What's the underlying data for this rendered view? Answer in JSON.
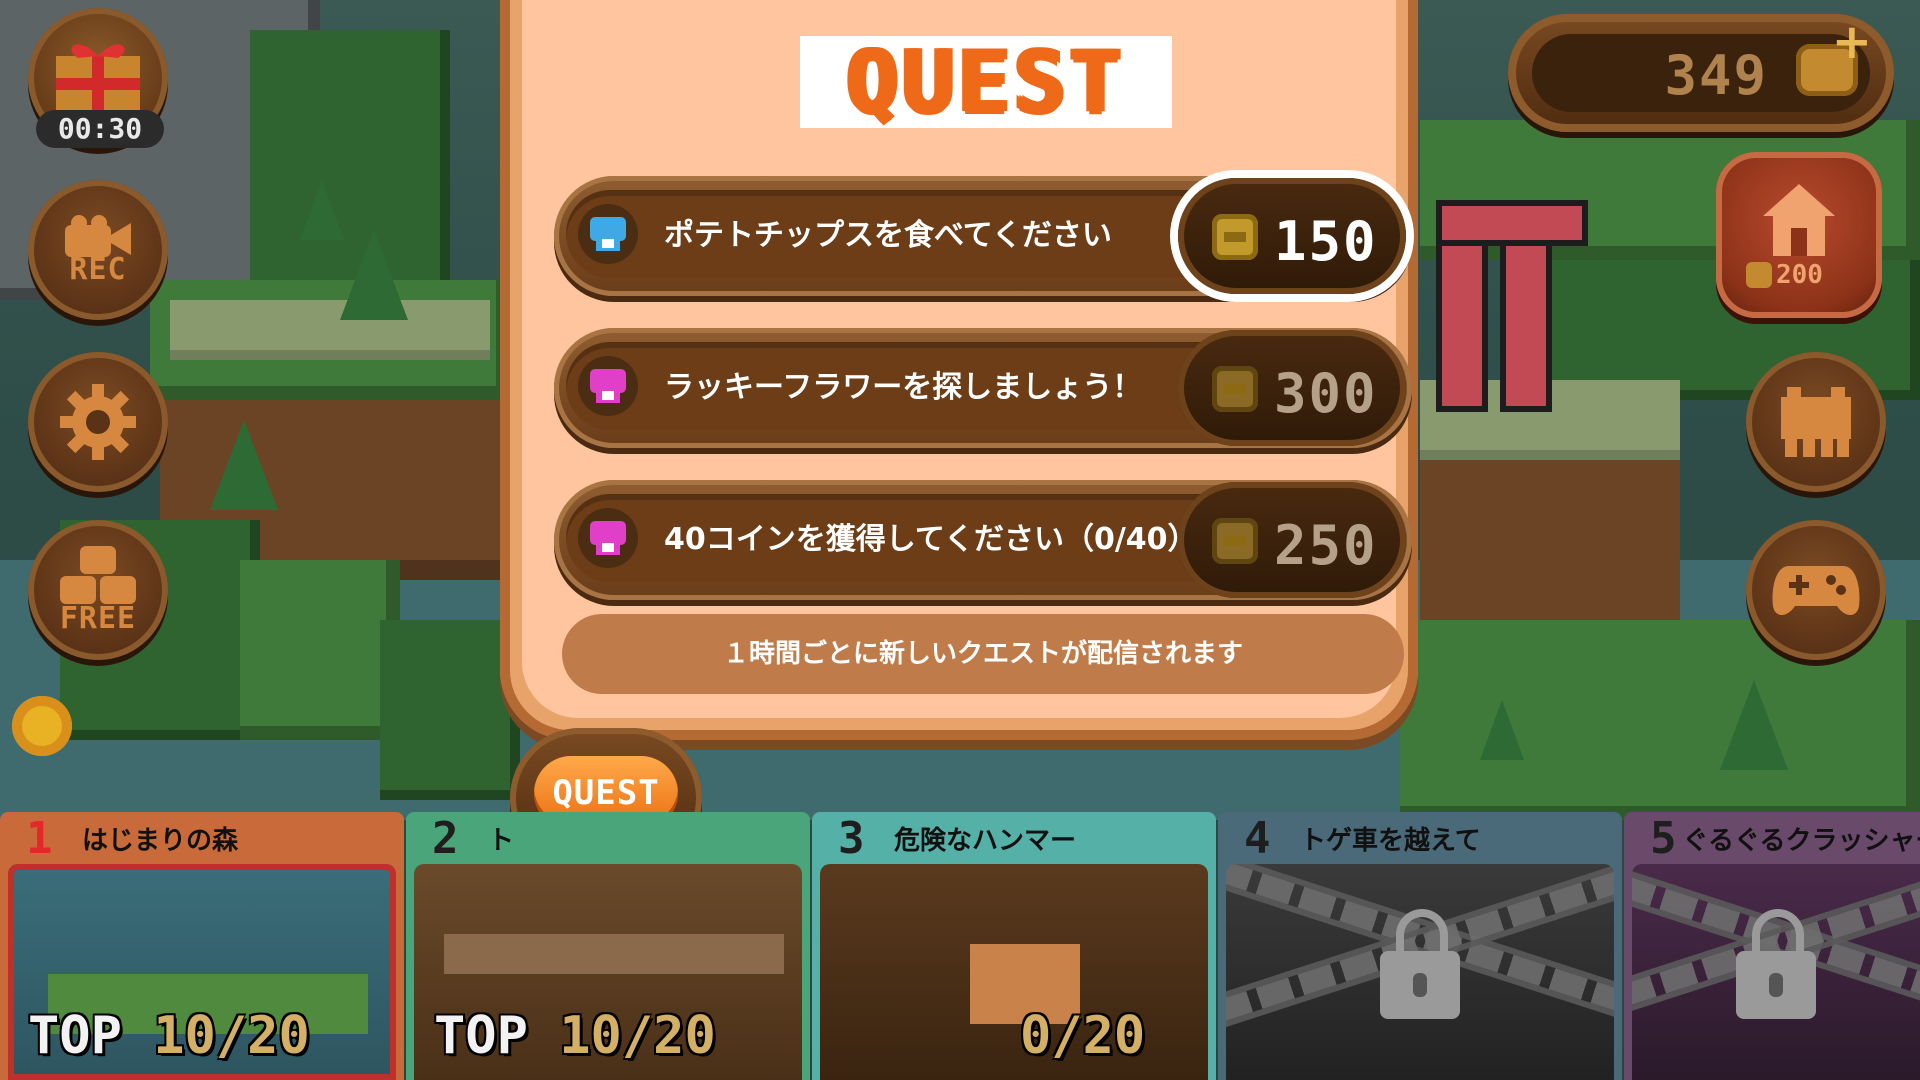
{
  "hud": {
    "gift_timer": "00:30",
    "rec_label": "REC",
    "free_label": "FREE",
    "coins": "349",
    "house_price": "200"
  },
  "quest_panel": {
    "title": "QUEST",
    "quests": [
      {
        "text": "ポテトチップスを食べてください",
        "reward": "150",
        "icon_color": "#3fa9e6",
        "active": true
      },
      {
        "text": "ラッキーフラワーを探しましょう！",
        "reward": "300",
        "icon_color": "#e040c8",
        "active": false
      },
      {
        "text": "40コインを獲得してください（0/40）",
        "reward": "250",
        "icon_color": "#e040c8",
        "active": false
      }
    ],
    "notice": "１時間ごとに新しいクエストが配信されます"
  },
  "quest_button": {
    "label": "QUEST"
  },
  "stages": [
    {
      "num": "1",
      "name": "はじまりの森",
      "score_prefix": "TOP",
      "score": "10/20",
      "locked": false,
      "color": "#c86a3a"
    },
    {
      "num": "2",
      "name": "ト",
      "score_prefix": "TOP",
      "score": "10/20",
      "locked": false,
      "color": "#4aa57a"
    },
    {
      "num": "3",
      "name": "危険なハンマー",
      "score_prefix": "",
      "score": "0/20",
      "locked": false,
      "color": "#55b0a8"
    },
    {
      "num": "4",
      "name": "トゲ車を越えて",
      "score_prefix": "",
      "score": "",
      "locked": true,
      "color": "#4a6a7a"
    },
    {
      "num": "5",
      "name": "ぐるぐるクラッシャー",
      "score_prefix": "",
      "score": "",
      "locked": true,
      "color": "#6a4a6a"
    }
  ]
}
